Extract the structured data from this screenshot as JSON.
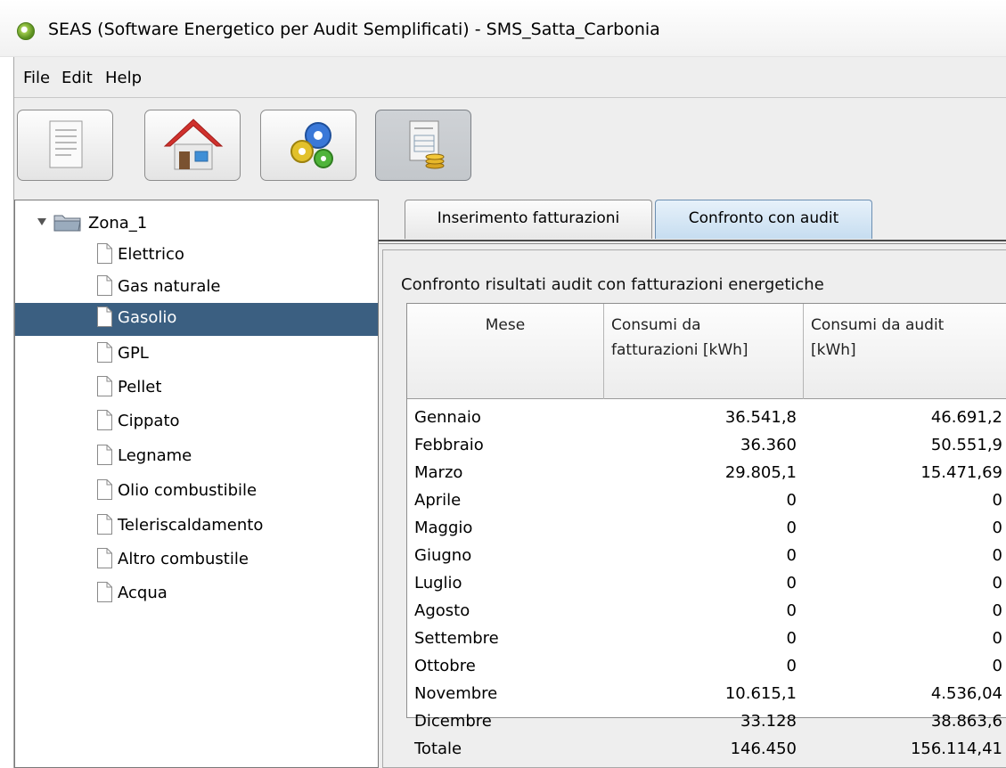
{
  "window": {
    "title": "SEAS (Software Energetico per Audit Semplificati) - SMS_Satta_Carbonia"
  },
  "menu": {
    "items": [
      "File",
      "Edit",
      "Help"
    ]
  },
  "toolbar": {
    "buttons": [
      {
        "name": "new-document",
        "icon": "document-icon"
      },
      {
        "name": "building",
        "icon": "house-icon"
      },
      {
        "name": "settings",
        "icon": "gears-icon"
      },
      {
        "name": "billing",
        "icon": "invoice-coins-icon",
        "pressed": true
      }
    ]
  },
  "tree": {
    "root_label": "Zona_1",
    "items": [
      {
        "label": "Elettrico"
      },
      {
        "label": "Gas naturale"
      },
      {
        "label": "Gasolio",
        "selected": true
      },
      {
        "label": "GPL"
      },
      {
        "label": "Pellet"
      },
      {
        "label": "Cippato"
      },
      {
        "label": "Legname"
      },
      {
        "label": "Olio combustibile"
      },
      {
        "label": "Teleriscaldamento"
      },
      {
        "label": "Altro combustile"
      },
      {
        "label": "Acqua"
      }
    ]
  },
  "tabs": [
    {
      "label": "Inserimento fatturazioni",
      "active": false
    },
    {
      "label": "Confronto con audit",
      "active": true
    }
  ],
  "comparison": {
    "section_label": "Confronto risultati audit con fatturazioni energetiche",
    "columns": {
      "month": "Mese",
      "billed_line1": "Consumi da",
      "billed_line2": "fatturazioni [kWh]",
      "audit_line1": "Consumi da audit",
      "audit_line2": "[kWh]"
    },
    "rows": [
      {
        "month": "Gennaio",
        "billed": "36.541,8",
        "audit": "46.691,2"
      },
      {
        "month": "Febbraio",
        "billed": "36.360",
        "audit": "50.551,9"
      },
      {
        "month": "Marzo",
        "billed": "29.805,1",
        "audit": "15.471,69"
      },
      {
        "month": "Aprile",
        "billed": "0",
        "audit": "0"
      },
      {
        "month": "Maggio",
        "billed": "0",
        "audit": "0"
      },
      {
        "month": "Giugno",
        "billed": "0",
        "audit": "0"
      },
      {
        "month": "Luglio",
        "billed": "0",
        "audit": "0"
      },
      {
        "month": "Agosto",
        "billed": "0",
        "audit": "0"
      },
      {
        "month": "Settembre",
        "billed": "0",
        "audit": "0"
      },
      {
        "month": "Ottobre",
        "billed": "0",
        "audit": "0"
      },
      {
        "month": "Novembre",
        "billed": "10.615,1",
        "audit": "4.536,04"
      },
      {
        "month": "Dicembre",
        "billed": "33.128",
        "audit": "38.863,6"
      },
      {
        "month": "Totale",
        "billed": "146.450",
        "audit": "156.114,41"
      }
    ]
  }
}
